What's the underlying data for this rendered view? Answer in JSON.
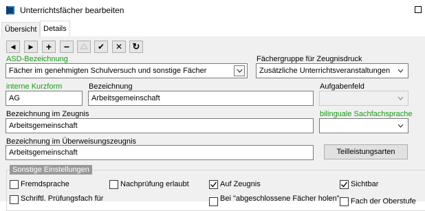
{
  "window": {
    "title": "Unterrichtsfächer bearbeiten",
    "app_icon": "book-icon",
    "maximize_icon": "maximize-icon"
  },
  "tabs": [
    {
      "label": "Übersicht",
      "active": false
    },
    {
      "label": "Details",
      "active": true
    }
  ],
  "toolbar": [
    {
      "name": "previous-button",
      "icon": "triangle-left-icon",
      "glyph": "◀",
      "enabled": true
    },
    {
      "name": "next-button",
      "icon": "triangle-right-icon",
      "glyph": "▶",
      "enabled": true
    },
    {
      "name": "add-button",
      "icon": "plus-icon",
      "glyph": "+",
      "enabled": true
    },
    {
      "name": "delete-button",
      "icon": "minus-icon",
      "glyph": "−",
      "enabled": true
    },
    {
      "name": "edit-button",
      "icon": "eraser-icon",
      "glyph": "⌂",
      "enabled": false
    },
    {
      "name": "save-button",
      "icon": "check-icon",
      "glyph": "✔",
      "enabled": true
    },
    {
      "name": "cancel-button",
      "icon": "x-icon",
      "glyph": "✕",
      "enabled": true
    },
    {
      "name": "refresh-button",
      "icon": "refresh-icon",
      "glyph": "↻",
      "enabled": true
    }
  ],
  "form": {
    "asd": {
      "label": "ASD-Bezeichnung",
      "value": "Fächer im genehmigten Schulversuch und sonstige Fächer"
    },
    "faechergruppe": {
      "label": "Fächergruppe für Zeugnisdruck",
      "value": "Zusätzliche Unterrichtsveranstaltungen"
    },
    "kurzform": {
      "label": "interne Kurzform",
      "value": "AG"
    },
    "bezeichnung": {
      "label": "Bezeichnung",
      "value": "Arbeitsgemeinschaft"
    },
    "aufgabenfeld": {
      "label": "Aufgabenfeld",
      "value": ""
    },
    "zeugnis": {
      "label": "Bezeichnung im Zeugnis",
      "value": "Arbeitsgemeinschaft"
    },
    "bilingual": {
      "label": "bilinguale Sachfachsprache",
      "value": ""
    },
    "ueberweisung": {
      "label": "Bezeichnung im Überweisungszeugnis",
      "value": "Arbeitsgemeinschaft"
    },
    "teilleistung_button": "Teilleistungsarten"
  },
  "settings": {
    "title": "Sonstige Einstellungen",
    "checkboxes": [
      {
        "label": "Fremdsprache",
        "checked": false
      },
      {
        "label": "Nachprüfung erlaubt",
        "checked": false
      },
      {
        "label": "Auf Zeugnis",
        "checked": true
      },
      {
        "label": "Sichtbar",
        "checked": true
      },
      {
        "label": "Schriftl. Prüfungsfach für",
        "checked": false
      },
      {
        "label": "Bei \"abgeschlossene Fächer holen\"",
        "checked": false
      },
      {
        "label": "Fach der Oberstufe",
        "checked": false
      }
    ]
  },
  "colors": {
    "accent_green": "#1a9b1a",
    "background": "#f0f0f0",
    "group_title_bg": "#9a9a9a"
  }
}
